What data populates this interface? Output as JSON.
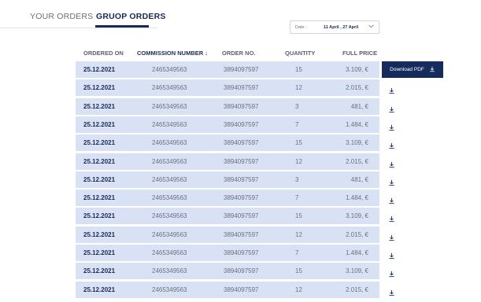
{
  "tabs": {
    "your_orders": "YOUR ORDERS",
    "group_orders": "GRUOP ORDERS"
  },
  "date_filter": {
    "label": "Date :",
    "value": "11 April , 27 April",
    "icon": "chevron-down-icon"
  },
  "table": {
    "headers": {
      "ordered_on": "ORDERED ON",
      "commission_number": "COMMISSION NUMBER ↓",
      "order_no": "ORDER NO.",
      "quantity": "QUANTITY",
      "full_price": "FULL PRICE"
    },
    "rows": [
      {
        "date": "25.12.2021",
        "commission": "2465349563",
        "order_no": "3894097597",
        "quantity": "15",
        "price": "3.109, €"
      },
      {
        "date": "25.12.2021",
        "commission": "2465349563",
        "order_no": "3894097597",
        "quantity": "12",
        "price": "2.015, €"
      },
      {
        "date": "25.12.2021",
        "commission": "2465349563",
        "order_no": "3894097597",
        "quantity": "3",
        "price": "481, €"
      },
      {
        "date": "25.12.2021",
        "commission": "2465349563",
        "order_no": "3894097597",
        "quantity": "7",
        "price": "1.484, €"
      },
      {
        "date": "25.12.2021",
        "commission": "2465349563",
        "order_no": "3894097597",
        "quantity": "15",
        "price": "3.109, €"
      },
      {
        "date": "25.12.2021",
        "commission": "2465349563",
        "order_no": "3894097597",
        "quantity": "12",
        "price": "2.015, €"
      },
      {
        "date": "25.12.2021",
        "commission": "2465349563",
        "order_no": "3894097597",
        "quantity": "3",
        "price": "481, €"
      },
      {
        "date": "25.12.2021",
        "commission": "2465349563",
        "order_no": "3894097597",
        "quantity": "7",
        "price": "1.484, €"
      },
      {
        "date": "25.12.2021",
        "commission": "2465349563",
        "order_no": "3894097597",
        "quantity": "15",
        "price": "3.109, €"
      },
      {
        "date": "25.12.2021",
        "commission": "2465349563",
        "order_no": "3894097597",
        "quantity": "12",
        "price": "2.015, €"
      },
      {
        "date": "25.12.2021",
        "commission": "2465349563",
        "order_no": "3894097597",
        "quantity": "7",
        "price": "1.484, €"
      },
      {
        "date": "25.12.2021",
        "commission": "2465349563",
        "order_no": "3894097597",
        "quantity": "15",
        "price": "3.109, €"
      },
      {
        "date": "25.12.2021",
        "commission": "2465349563",
        "order_no": "3894097597",
        "quantity": "12",
        "price": "2.015, €"
      }
    ]
  },
  "download": {
    "button_label": "Download PDF",
    "icon": "download-icon"
  },
  "colors": {
    "primary": "#152b5e",
    "row_bg": "#d9e1f4"
  }
}
